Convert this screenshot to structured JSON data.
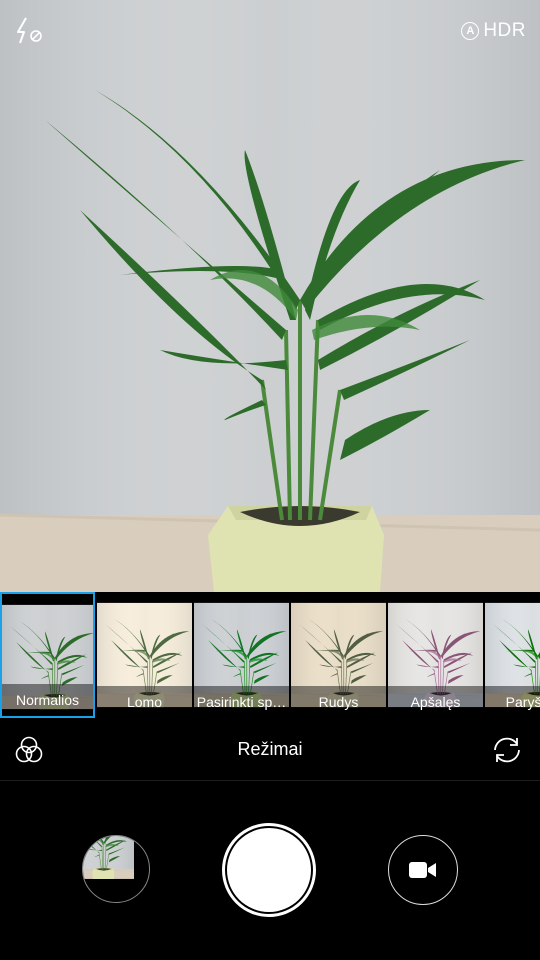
{
  "top_bar": {
    "flash_icon": "flash-off-icon",
    "hdr_badge": "A",
    "hdr_label": "HDR"
  },
  "filters": [
    {
      "label": "Normalios",
      "selected": true
    },
    {
      "label": "Lomo",
      "selected": false
    },
    {
      "label": "Pasirinkti sp…",
      "selected": false
    },
    {
      "label": "Rudys",
      "selected": false
    },
    {
      "label": "Apšalęs",
      "selected": false
    },
    {
      "label": "Paryškin",
      "selected": false
    }
  ],
  "modes": {
    "filters_icon": "color-filters-icon",
    "label": "Režimai",
    "switch_icon": "switch-camera-icon"
  },
  "controls": {
    "gallery_icon": "gallery-thumbnail",
    "shutter_icon": "shutter-button",
    "video_icon": "video-camera-icon"
  },
  "colors": {
    "accent": "#1aa0e8",
    "background": "#000000"
  }
}
